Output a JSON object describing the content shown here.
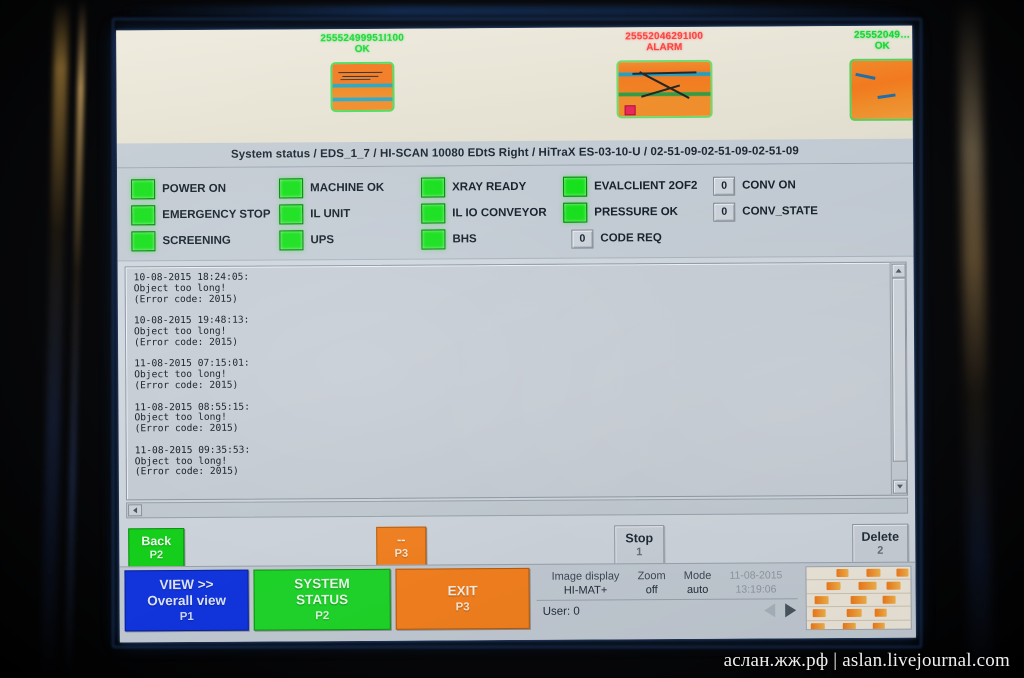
{
  "device": {
    "screen_label": "hi-scan-eds-control-screen"
  },
  "xray_strip": {
    "bags": [
      {
        "id": "25552499951I100",
        "state": "OK",
        "state_color": "#11d82e"
      },
      {
        "id": "25552046291I00",
        "state": "ALARM",
        "state_color": "#ff3b3b"
      },
      {
        "id": "25552049…",
        "state": "OK",
        "state_color": "#11d82e"
      }
    ]
  },
  "statusbar": {
    "text": "System status  /  EDS_1_7  /  HI-SCAN 10080 EDtS Right  /  HiTraX ES-03-10-U  /  02-51-09-02-51-09-02-51-09",
    "parts": {
      "title": "System status",
      "eds": "EDS_1_7",
      "machine": "HI-SCAN 10080 EDtS Right",
      "tracker": "HiTraX ES-03-10-U",
      "code": "02-51-09-02-51-09-02-51-09"
    }
  },
  "indicators": {
    "lamp_color": "#17e01d",
    "rows": [
      [
        {
          "type": "lamp",
          "label": "POWER ON",
          "value": ""
        },
        {
          "type": "lamp",
          "label": "MACHINE OK",
          "value": ""
        },
        {
          "type": "lamp",
          "label": "XRAY READY",
          "value": ""
        },
        {
          "type": "lamp",
          "label": "EVALCLIENT 2OF2",
          "value": ""
        },
        {
          "type": "num",
          "label": "CONV ON",
          "value": "0"
        }
      ],
      [
        {
          "type": "lamp",
          "label": "EMERGENCY STOP",
          "value": ""
        },
        {
          "type": "lamp",
          "label": "IL UNIT",
          "value": ""
        },
        {
          "type": "lamp",
          "label": "IL IO CONVEYOR",
          "value": ""
        },
        {
          "type": "lamp",
          "label": "PRESSURE OK",
          "value": ""
        },
        {
          "type": "num",
          "label": "CONV_STATE",
          "value": "0"
        }
      ],
      [
        {
          "type": "lamp",
          "label": "SCREENING",
          "value": ""
        },
        {
          "type": "lamp",
          "label": "UPS",
          "value": ""
        },
        {
          "type": "lamp",
          "label": "BHS",
          "value": ""
        },
        {
          "type": "num",
          "label": "CODE REQ",
          "value": "0"
        }
      ]
    ]
  },
  "log": {
    "text": "10-08-2015 18:24:05:\nObject too long!\n(Error code: 2015)\n\n10-08-2015 19:48:13:\nObject too long!\n(Error code: 2015)\n\n11-08-2015 07:15:01:\nObject too long!\n(Error code: 2015)\n\n11-08-2015 08:55:15:\nObject too long!\n(Error code: 2015)\n\n11-08-2015 09:35:53:\nObject too long!\n(Error code: 2015)",
    "entries": [
      {
        "timestamp": "10-08-2015 18:24:05:",
        "message": "Object too long!",
        "code": "(Error code: 2015)"
      },
      {
        "timestamp": "10-08-2015 19:48:13:",
        "message": "Object too long!",
        "code": "(Error code: 2015)"
      },
      {
        "timestamp": "11-08-2015 07:15:01:",
        "message": "Object too long!",
        "code": "(Error code: 2015)"
      },
      {
        "timestamp": "11-08-2015 08:55:15:",
        "message": "Object too long!",
        "code": "(Error code: 2015)"
      },
      {
        "timestamp": "11-08-2015 09:35:53:",
        "message": "Object too long!",
        "code": "(Error code: 2015)"
      }
    ]
  },
  "function_buttons": [
    {
      "label": "Back",
      "key": "P2",
      "color": "#15d21c",
      "style": "green"
    },
    {
      "label": "--",
      "key": "P3",
      "color": "#f5811f",
      "style": "orange"
    },
    {
      "label": "Stop",
      "key": "1",
      "color": "#c9d0d8",
      "style": "grey"
    },
    {
      "label": "Delete",
      "key": "2",
      "color": "#c9d0d8",
      "style": "grey"
    }
  ],
  "bottom_buttons": [
    {
      "line1": "VIEW >>",
      "line2": "Overall view",
      "key": "P1",
      "color": "#1136e0",
      "style": "blue"
    },
    {
      "line1": "SYSTEM",
      "line2": "STATUS",
      "key": "P2",
      "color": "#1fd72a",
      "style": "green"
    },
    {
      "line1": "EXIT",
      "line2": "",
      "key": "P3",
      "color": "#f5811f",
      "style": "orange"
    }
  ],
  "info": {
    "image_display_key": "Image display",
    "image_display_value": "HI-MAT+",
    "zoom_key": "Zoom",
    "zoom_value": "off",
    "mode_key": "Mode",
    "mode_value": "auto",
    "date": "11-08-2015",
    "time": "13:19:06",
    "user": "User: 0"
  },
  "watermark": "аслан.жж.рф | aslan.livejournal.com"
}
